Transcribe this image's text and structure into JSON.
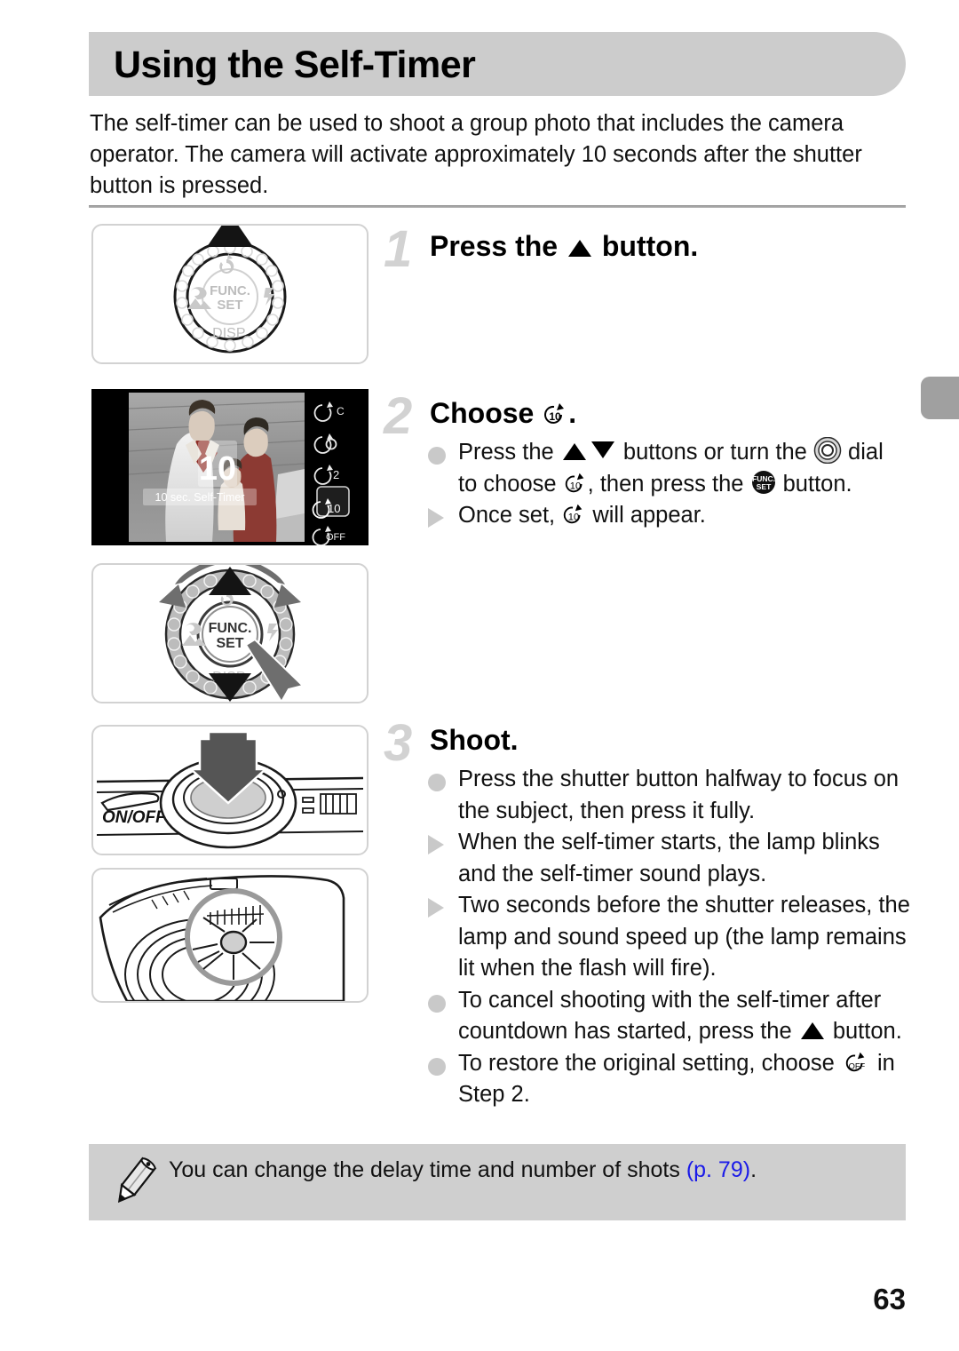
{
  "header": {
    "title": "Using the Self-Timer"
  },
  "intro": "The self-timer can be used to shoot a group photo that includes the camera operator. The camera will activate approximately 10 seconds after the shutter button is pressed.",
  "steps": [
    {
      "number": "1",
      "heading_before": "Press the ",
      "heading_icon": "up-button-icon",
      "heading_after": " button.",
      "bullets": []
    },
    {
      "number": "2",
      "heading_before": "Choose ",
      "heading_icon": "self-timer-10sec-icon",
      "heading_after": ".",
      "bullets": [
        {
          "mark": "dot",
          "parts": [
            "Press the ",
            "up-down-buttons-icon",
            " buttons or turn the ",
            "control-dial-icon",
            " dial"
          ],
          "line2_parts": [
            "to choose ",
            "self-timer-10sec-icon",
            ", then press the ",
            "func-set-icon",
            " button."
          ]
        },
        {
          "mark": "triangle",
          "parts": [
            "Once set, ",
            "self-timer-10sec-icon",
            " will appear."
          ]
        }
      ]
    },
    {
      "number": "3",
      "heading_before": "Shoot.",
      "heading_icon": "",
      "heading_after": "",
      "bullets": [
        {
          "mark": "dot",
          "text": "Press the shutter button halfway to focus on the subject, then press it fully."
        },
        {
          "mark": "triangle",
          "text": "When the self-timer starts, the lamp blinks and the self-timer sound plays."
        },
        {
          "mark": "triangle",
          "text": "Two seconds before the shutter releases, the lamp and sound speed up (the lamp remains lit when the flash will fire)."
        },
        {
          "mark": "dot",
          "text_a": "To cancel shooting with the self-timer after countdown has started, press the ",
          "icon": "up-button-icon",
          "text_b": " button."
        },
        {
          "mark": "dot",
          "text_a": "To restore the original setting, choose ",
          "icon": "self-timer-off-icon",
          "text_b": " in Step 2."
        }
      ]
    }
  ],
  "figures": {
    "dial1": {
      "name": "camera-control-dial-up-press",
      "center_label_line1": "FUNC.",
      "center_label_line2": "SET",
      "bottom_label": "DISP.",
      "icons": [
        "self-timer-icon",
        "macro-icon",
        "landscape-icon",
        "flash-icon"
      ]
    },
    "lcd": {
      "name": "camera-lcd-self-timer-menu",
      "overlay_count": "10",
      "caption": "10 sec. Self-Timer",
      "menu_items": [
        "self-timer-custom-icon",
        "self-timer-face-icon",
        "self-timer-2sec-icon",
        "self-timer-10sec-icon",
        "self-timer-off-icon"
      ],
      "selected_index": 3
    },
    "dial2": {
      "name": "camera-control-dial-turn-and-set",
      "center_label_line1": "FUNC.",
      "center_label_line2": "SET",
      "bottom_label": "DISP."
    },
    "top": {
      "name": "camera-top-shutter-button",
      "label": "ON/OFF"
    },
    "front": {
      "name": "camera-front-self-timer-lamp"
    }
  },
  "note": {
    "icon": "pencil-icon",
    "text_before": "You can change the delay time and number of shots ",
    "link": "(p. 79)",
    "text_after": "."
  },
  "page_number": "63",
  "colors": {
    "header_bg": "#cccccc",
    "note_bg": "#cfcfcf",
    "step_number": "#d2d2d2",
    "bullet": "#c9c9c9",
    "link": "#1a1ae8",
    "edge_tab": "#a0a0a0"
  }
}
